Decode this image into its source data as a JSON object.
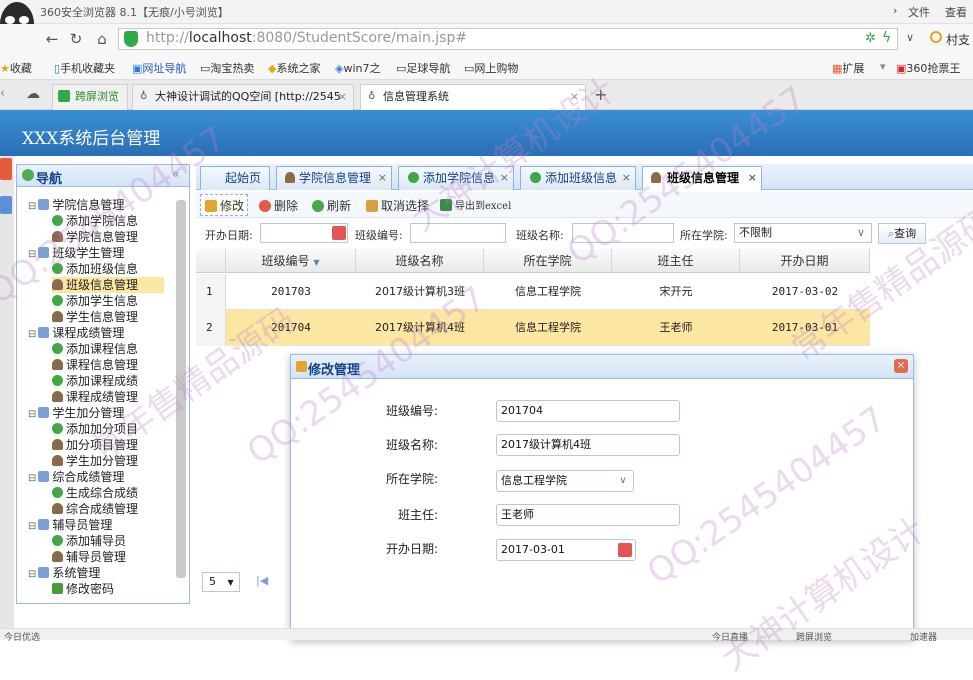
{
  "browser": {
    "window_title": "360安全浏览器 8.1【无痕/小号浏览】",
    "menu": [
      "文件",
      "查看"
    ],
    "url_prefix": "http://",
    "url_host": "localhost",
    "url_rest": ":8080/StudentScore/main.jsp#",
    "search_hint": "村支",
    "bookmarks": [
      "收藏",
      "手机收藏夹",
      "网址导航",
      "淘宝热卖",
      "系统之家",
      "win7之",
      "足球导航",
      "网上购物"
    ],
    "bookmarks_right": [
      "扩展",
      "360抢票王"
    ],
    "tabs": [
      {
        "label": "跨屏浏览"
      },
      {
        "label": "大神设计调试的QQ空间 [http://2545"
      },
      {
        "label": "信息管理系统"
      }
    ],
    "new_tab": "+",
    "close_glyph": "×",
    "status_left": "今日优选",
    "status_right": [
      "今日直播",
      "跨屏浏览",
      "加速器"
    ]
  },
  "app": {
    "title": "XXX系统后台管理"
  },
  "nav": {
    "title": "导航",
    "collapse": "«",
    "items": [
      {
        "label": "学院信息管理",
        "type": "folder",
        "level": 0
      },
      {
        "label": "添加学院信息",
        "type": "add",
        "level": 1
      },
      {
        "label": "学院信息管理",
        "type": "user",
        "level": 1
      },
      {
        "label": "班级学生管理",
        "type": "folder",
        "level": 0
      },
      {
        "label": "添加班级信息",
        "type": "add",
        "level": 1
      },
      {
        "label": "班级信息管理",
        "type": "user",
        "level": 1,
        "selected": true
      },
      {
        "label": "添加学生信息",
        "type": "add",
        "level": 1
      },
      {
        "label": "学生信息管理",
        "type": "user",
        "level": 1
      },
      {
        "label": "课程成绩管理",
        "type": "folder",
        "level": 0
      },
      {
        "label": "添加课程信息",
        "type": "add",
        "level": 1
      },
      {
        "label": "课程信息管理",
        "type": "user",
        "level": 1
      },
      {
        "label": "添加课程成绩",
        "type": "add",
        "level": 1
      },
      {
        "label": "课程成绩管理",
        "type": "user",
        "level": 1
      },
      {
        "label": "学生加分管理",
        "type": "folder",
        "level": 0
      },
      {
        "label": "添加加分项目",
        "type": "add",
        "level": 1
      },
      {
        "label": "加分项目管理",
        "type": "user",
        "level": 1
      },
      {
        "label": "学生加分管理",
        "type": "user",
        "level": 1
      },
      {
        "label": "综合成绩管理",
        "type": "folder",
        "level": 0
      },
      {
        "label": "生成综合成绩",
        "type": "add",
        "level": 1
      },
      {
        "label": "综合成绩管理",
        "type": "user",
        "level": 1
      },
      {
        "label": "辅导员管理",
        "type": "folder",
        "level": 0
      },
      {
        "label": "添加辅导员",
        "type": "add",
        "level": 1
      },
      {
        "label": "辅导员管理",
        "type": "user",
        "level": 1
      },
      {
        "label": "系统管理",
        "type": "folder",
        "level": 0
      },
      {
        "label": "修改密码",
        "type": "pen",
        "level": 1
      }
    ]
  },
  "tabs": [
    {
      "label": "起始页",
      "closable": false
    },
    {
      "label": "学院信息管理",
      "closable": true
    },
    {
      "label": "添加学院信息",
      "closable": true
    },
    {
      "label": "添加班级信息",
      "closable": true
    },
    {
      "label": "班级信息管理",
      "closable": true,
      "active": true
    }
  ],
  "toolbar": {
    "edit": "修改",
    "delete": "删除",
    "refresh": "刷新",
    "cancel_select": "取消选择",
    "export": "导出到excel"
  },
  "search": {
    "date_label": "开办日期:",
    "code_label": "班级编号:",
    "name_label": "班级名称:",
    "college_label": "所在学院:",
    "college_value": "不限制",
    "query": "查询",
    "select_arrow": "∨"
  },
  "grid": {
    "headers": [
      "班级编号",
      "班级名称",
      "所在学院",
      "班主任",
      "开办日期"
    ],
    "sort_glyph": "▼",
    "rows": [
      {
        "num": "1",
        "cells": [
          "201703",
          "2017级计算机3班",
          "信息工程学院",
          "宋开元",
          "2017-03-02"
        ]
      },
      {
        "num": "2",
        "cells": [
          "201704",
          "2017级计算机4班",
          "信息工程学院",
          "王老师",
          "2017-03-01"
        ],
        "selected": true
      }
    ],
    "page_size": "5",
    "page_size_arrow": "▼",
    "first_glyph": "|◀"
  },
  "dialog": {
    "title": "修改管理",
    "close_glyph": "×",
    "fields": [
      {
        "label": "班级编号:",
        "value": "201704"
      },
      {
        "label": "班级名称:",
        "value": "2017级计算机4班"
      },
      {
        "label": "所在学院:",
        "value": "信息工程学院"
      },
      {
        "label": "班主任:",
        "value": "王老师"
      },
      {
        "label": "开办日期:",
        "value": "2017-03-01"
      }
    ],
    "select_arrow": "∨"
  },
  "watermarks": [
    "QQ:2545404457",
    "常年售精品源码",
    "大神计算机设计"
  ],
  "colors": {
    "header_blue": "#2a6fb6",
    "selected_row": "#fbe6a2",
    "panel_border": "#99bbe8"
  }
}
